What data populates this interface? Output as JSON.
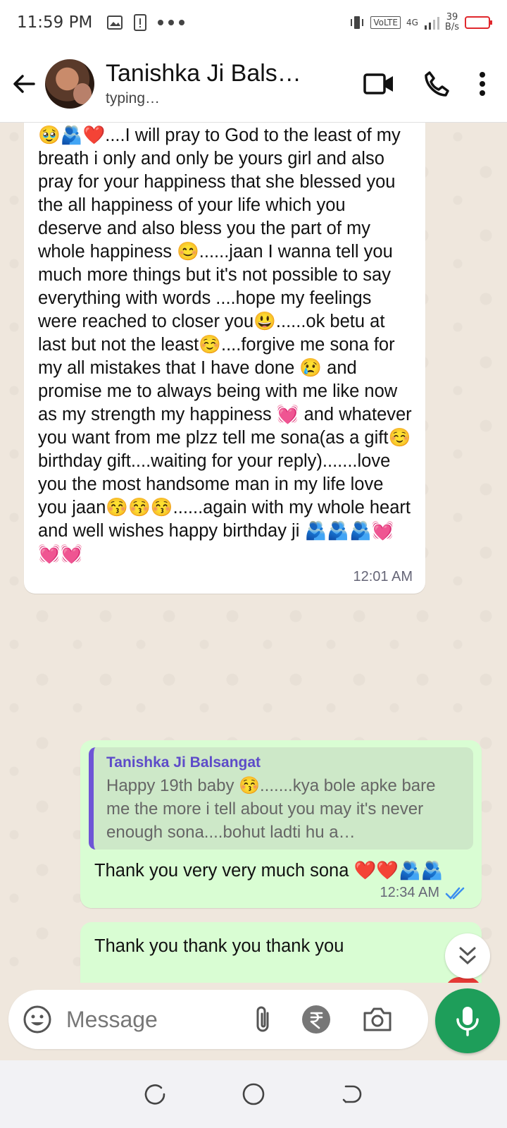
{
  "status_bar": {
    "time": "11:59 PM",
    "network": "VoLTE",
    "network_gen": "4G",
    "speed_value": "39",
    "speed_unit": "B/s"
  },
  "header": {
    "contact_name": "Tanishka Ji Bals…",
    "contact_status": "typing…"
  },
  "messages": {
    "incoming": {
      "text": "🥹🫂❤️....I will pray to God to the least of my breath i only and only be yours girl and also pray for your happiness that she blessed you the all happiness of your life which you deserve and also bless you the part of my whole happiness 😊......jaan I wanna tell you much more things but it's not possible to say everything with words ....hope my feelings were reached to closer you😃......ok betu at last but not the least☺️....forgive me sona for my all mistakes that I have done 😢 and promise me to always being with me like now as my strength my happiness 💓 and whatever you want from me plzz tell me sona(as a gift☺️ birthday gift....waiting for your reply).......love you the most handsome man in my life love you jaan😚😚😚......again with my whole heart and well wishes happy birthday ji 🫂🫂🫂💓💓💓",
      "time": "12:01 AM"
    },
    "outgoing_reply": {
      "quote_author": "Tanishka Ji Balsangat",
      "quote_text": "Happy 19th baby 😚.......kya bole apke bare me the more i tell about you may it's never enough sona....bohut ladti hu a…",
      "text": "Thank you very very much sona ❤️❤️🫂🫂",
      "time": "12:34 AM"
    },
    "outgoing_partial": {
      "text": "Thank you thank you thank you"
    }
  },
  "composer": {
    "placeholder": "Message"
  },
  "colors": {
    "header_bg": "#ffffff",
    "chat_bg": "#efe7dd",
    "outgoing_bubble": "#d9fdd3",
    "incoming_bubble": "#ffffff",
    "accent_green": "#1e9e5a",
    "read_ticks": "#3b8ef0",
    "quote_bar": "#6e55d6"
  }
}
